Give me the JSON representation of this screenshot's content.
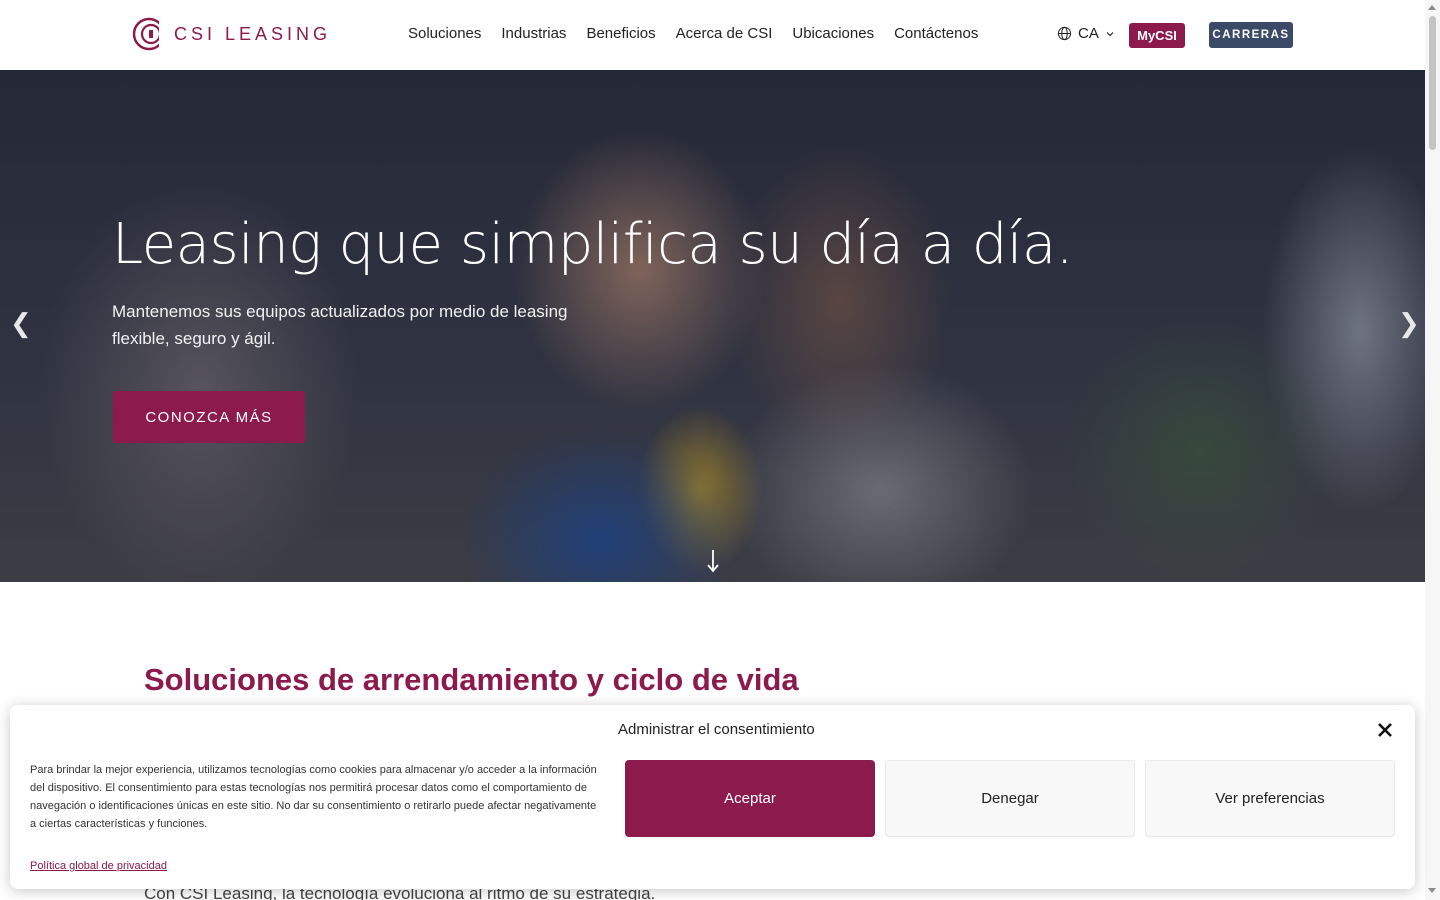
{
  "header": {
    "logo_text": "CSI LEASING",
    "nav": [
      {
        "label": "Soluciones"
      },
      {
        "label": "Industrias"
      },
      {
        "label": "Beneficios"
      },
      {
        "label": "Acerca de CSI"
      },
      {
        "label": "Ubicaciones"
      },
      {
        "label": "Contáctenos"
      }
    ],
    "language": "CA",
    "mycsi_label": "MyCSI",
    "careers_label": "CARRERAS"
  },
  "hero": {
    "title": "Leasing que simplifica su día a día.",
    "subtitle": "Mantenemos sus equipos actualizados por medio de leasing flexible, seguro y ágil.",
    "cta_label": "CONOZCA MÁS",
    "prev_arrow": "❮",
    "next_arrow": "❯"
  },
  "section": {
    "title": "Soluciones de arrendamiento y ciclo de vida",
    "text": "Con CSI Leasing, la tecnología evoluciona al ritmo de su estrategia."
  },
  "consent": {
    "title": "Administrar el consentimiento",
    "text": "Para brindar la mejor experiencia, utilizamos tecnologías como cookies para almacenar y/o acceder a la información del dispositivo. El consentimiento para estas tecnologías nos permitirá procesar datos como el comportamiento de navegación o identificaciones únicas en este sitio. No dar su consentimiento o retirarlo puede afectar negativamente a ciertas características y funciones.",
    "privacy_link": "Política global de privacidad",
    "accept_label": "Aceptar",
    "deny_label": "Denegar",
    "preferences_label": "Ver preferencias"
  },
  "colors": {
    "brand": "#8c1a4c",
    "careers_button": "#3b4a66"
  },
  "icons": {
    "logo": "csi-logo-icon",
    "language": "globe-icon",
    "dropdown": "chevron-down-icon",
    "scroll": "arrow-down-icon",
    "close": "close-icon"
  }
}
